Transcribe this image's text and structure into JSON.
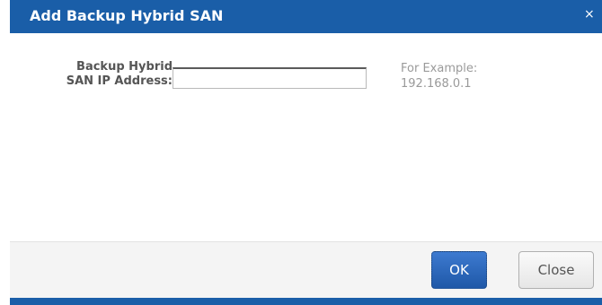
{
  "dialog": {
    "title": "Add Backup Hybrid SAN",
    "close_glyph": "×",
    "close_icon": "close-icon"
  },
  "form": {
    "label_line1": "Backup Hybrid",
    "label_line2": "SAN IP Address:",
    "ip_value": "",
    "hint_line1": "For Example:",
    "hint_line2": "192.168.0.1"
  },
  "footer": {
    "ok_label": "OK",
    "close_label": "Close"
  },
  "colors": {
    "titlebar": "#1a5ea8",
    "ok_button": "#2a64b8",
    "hint_text": "#9a9a9a",
    "label_text": "#555555"
  }
}
